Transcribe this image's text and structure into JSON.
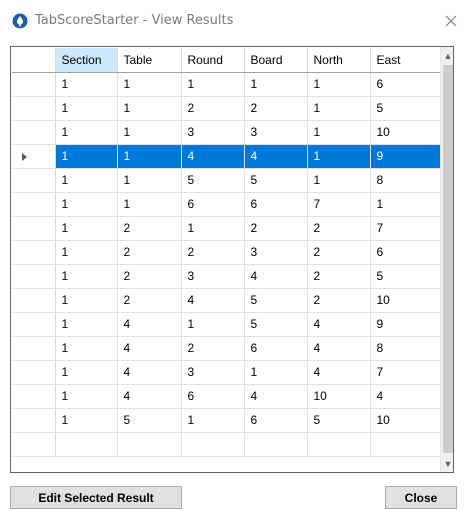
{
  "window": {
    "title": "TabScoreStarter - View Results"
  },
  "grid": {
    "columns": [
      "Section",
      "Table",
      "Round",
      "Board",
      "North",
      "East"
    ],
    "sorted_column": "Section",
    "rows": [
      [
        "1",
        "1",
        "1",
        "1",
        "1",
        "6"
      ],
      [
        "1",
        "1",
        "2",
        "2",
        "1",
        "5"
      ],
      [
        "1",
        "1",
        "3",
        "3",
        "1",
        "10"
      ],
      [
        "1",
        "1",
        "4",
        "4",
        "1",
        "9"
      ],
      [
        "1",
        "1",
        "5",
        "5",
        "1",
        "8"
      ],
      [
        "1",
        "1",
        "6",
        "6",
        "7",
        "1"
      ],
      [
        "1",
        "2",
        "1",
        "2",
        "2",
        "7"
      ],
      [
        "1",
        "2",
        "2",
        "3",
        "2",
        "6"
      ],
      [
        "1",
        "2",
        "3",
        "4",
        "2",
        "5"
      ],
      [
        "1",
        "2",
        "4",
        "5",
        "2",
        "10"
      ],
      [
        "1",
        "4",
        "1",
        "5",
        "4",
        "9"
      ],
      [
        "1",
        "4",
        "2",
        "6",
        "4",
        "8"
      ],
      [
        "1",
        "4",
        "3",
        "1",
        "4",
        "7"
      ],
      [
        "1",
        "4",
        "6",
        "4",
        "10",
        "4"
      ],
      [
        "1",
        "5",
        "1",
        "6",
        "5",
        "10"
      ],
      [
        "",
        "",
        "",
        "",
        "",
        ""
      ]
    ],
    "selected_row_index": 3,
    "selection_color": "#0078d7",
    "header_highlight_color": "#cce8ff"
  },
  "buttons": {
    "edit_label": "Edit Selected Result",
    "close_label": "Close"
  },
  "icons": {
    "app": "app-logo-icon",
    "close": "close-icon",
    "current_row": "row-pointer-icon",
    "scroll_up": "scroll-up-icon",
    "scroll_down": "scroll-down-icon"
  }
}
